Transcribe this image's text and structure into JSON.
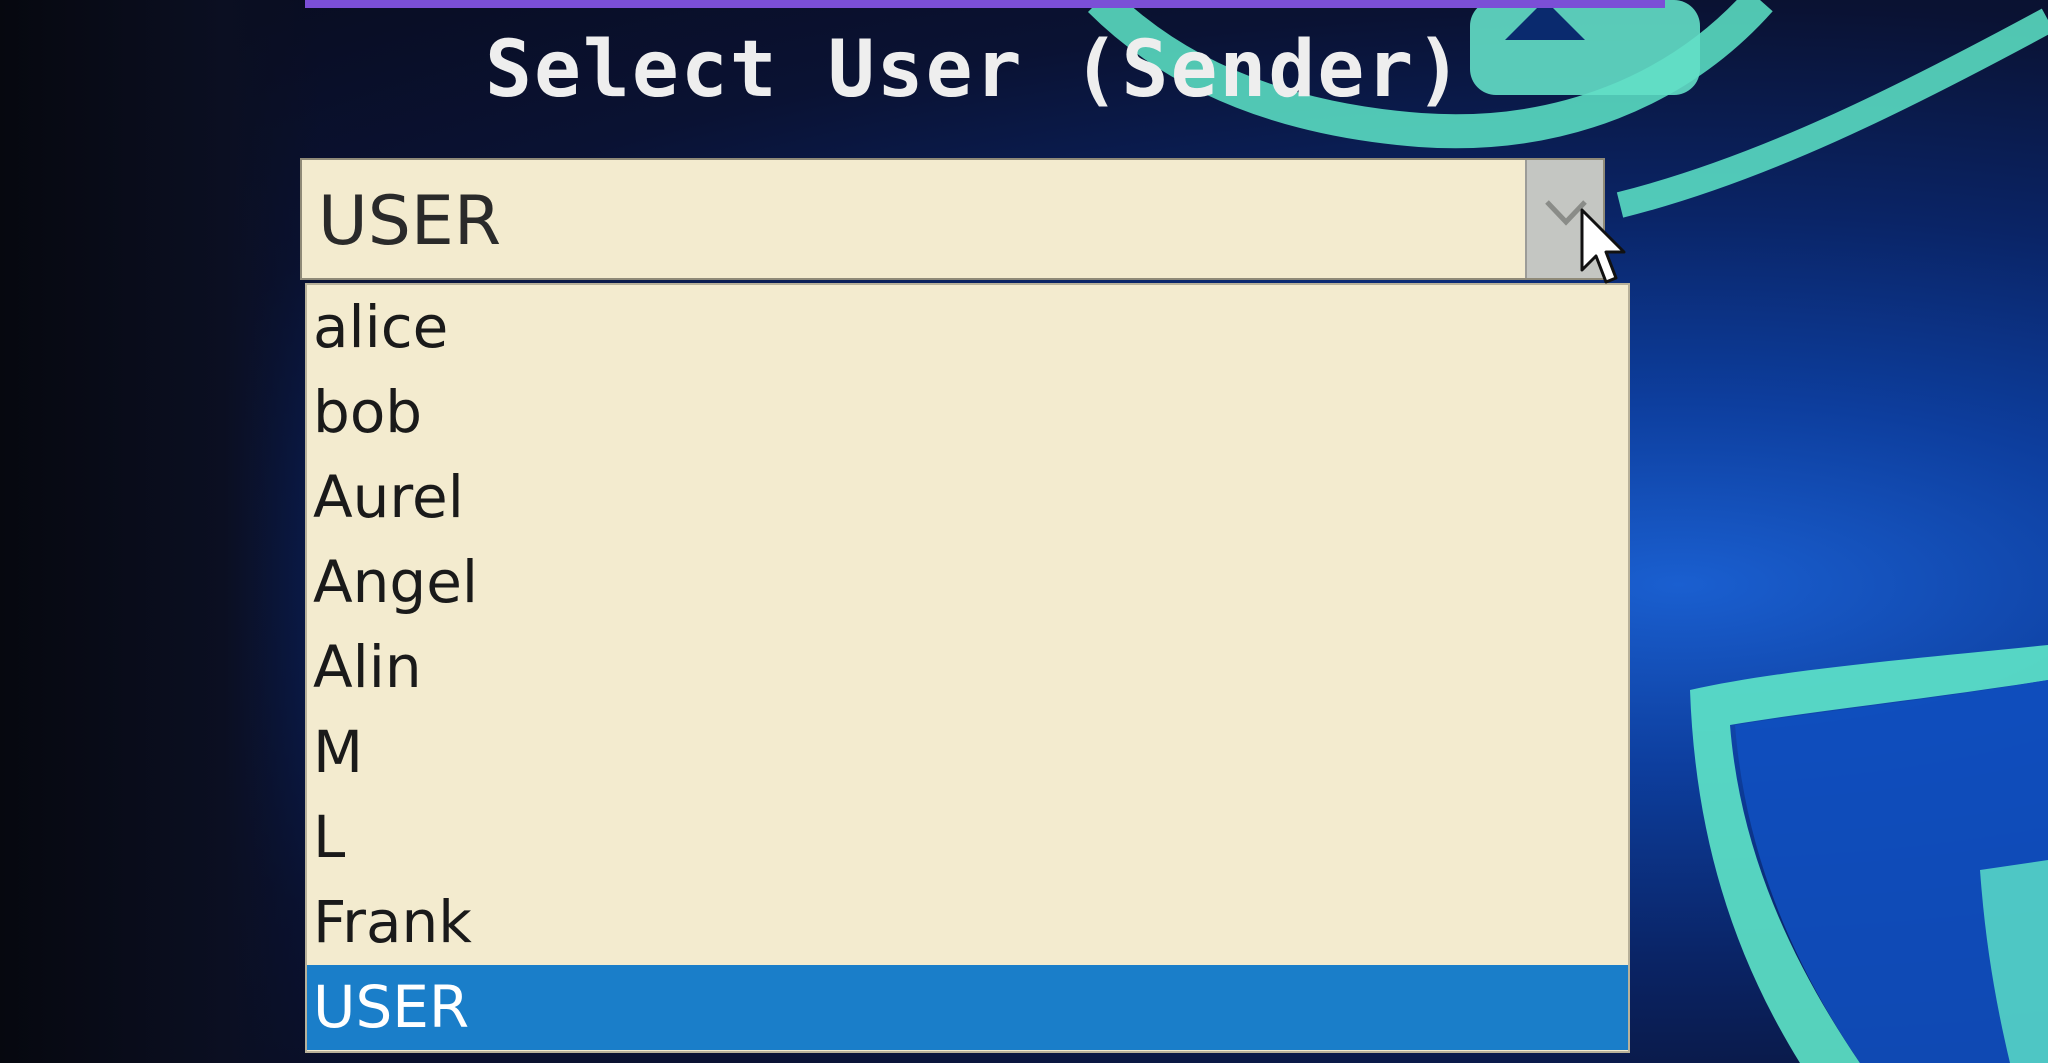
{
  "dialog": {
    "title": "Select User (Sender)"
  },
  "combo": {
    "selected_value": "USER",
    "button_icon": "chevron-down-icon"
  },
  "dropdown": {
    "options": [
      {
        "label": "alice",
        "selected": false
      },
      {
        "label": "bob",
        "selected": false
      },
      {
        "label": "Aurel",
        "selected": false
      },
      {
        "label": "Angel",
        "selected": false
      },
      {
        "label": "Alin",
        "selected": false
      },
      {
        "label": "M",
        "selected": false
      },
      {
        "label": "L",
        "selected": false
      },
      {
        "label": "Frank",
        "selected": false
      },
      {
        "label": "USER",
        "selected": true
      }
    ]
  },
  "colors": {
    "list_background": "#f3ebcf",
    "selection_highlight": "#1a7ec9",
    "title_text": "#eeeeee",
    "accent_bar": "#7b4fd6",
    "wallpaper_glow": "#5ee6c8"
  },
  "icons": {
    "pointer": "mouse-pointer-icon"
  }
}
